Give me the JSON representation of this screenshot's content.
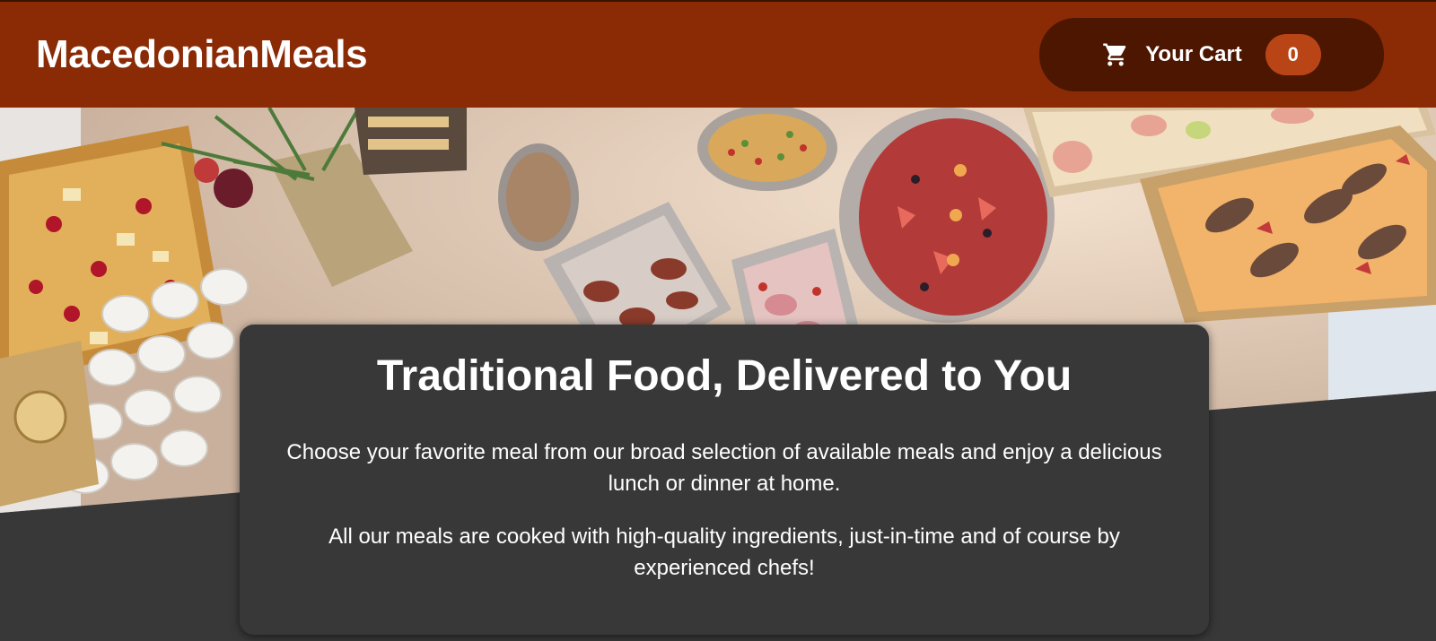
{
  "header": {
    "brand": "MacedonianMeals",
    "cart_label": "Your Cart",
    "cart_count": "0",
    "cart_icon": "shopping-cart-icon"
  },
  "hero": {
    "image_subject": "buffet table with platters of traditional food"
  },
  "summary": {
    "title": "Traditional Food, Delivered to You",
    "paragraph_1": "Choose your favorite meal from our broad selection of available meals and enjoy a delicious lunch or dinner at home.",
    "paragraph_2": "All our meals are cooked with high-quality ingredients, just-in-time and of course by experienced chefs!"
  },
  "colors": {
    "header_bg": "#8a2b06",
    "cart_bg": "#4d1601",
    "badge_bg": "#b94517",
    "page_bg": "#383838",
    "text": "#ffffff"
  }
}
